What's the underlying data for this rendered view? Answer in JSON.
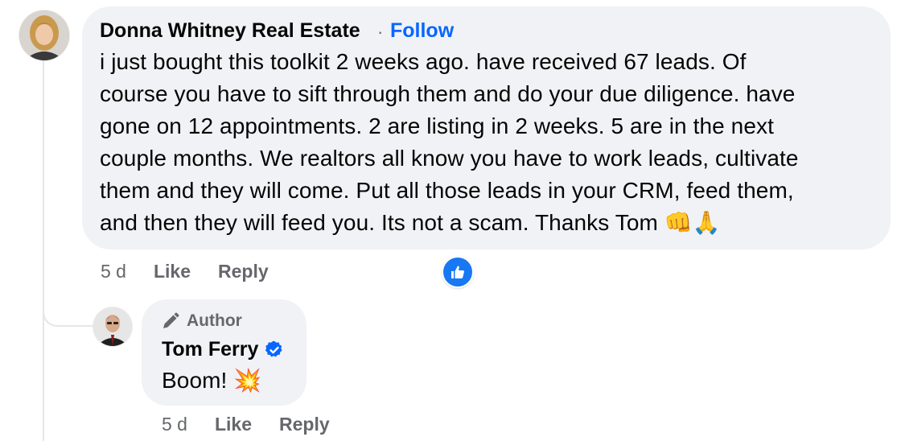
{
  "comment": {
    "author": "Donna Whitney Real Estate",
    "separator": "·",
    "follow_label": "Follow",
    "lines": [
      "i just bought this toolkit 2 weeks ago. have received 67 leads. Of",
      "course you have to sift through them and do your due diligence. have",
      "gone on 12 appointments. 2 are listing in 2 weeks. 5 are in the next",
      "couple months. We realtors all know you have to work leads, cultivate",
      "them and they will come. Put all those leads in your CRM, feed them,",
      "and then they will feed you. Its not a scam. Thanks Tom 👊🙏"
    ],
    "time": "5 d",
    "like_label": "Like",
    "reply_label": "Reply",
    "reaction": "like"
  },
  "reply": {
    "badge_label": "Author",
    "badge_icon": "pen-icon",
    "author": "Tom Ferry",
    "verified": true,
    "text": "Boom! 💥",
    "time": "5 d",
    "like_label": "Like",
    "reply_label": "Reply"
  },
  "colors": {
    "bubble": "#f0f2f5",
    "link": "#0866ff",
    "secondary_text": "#65676b",
    "like_badge": "#1877f2"
  }
}
